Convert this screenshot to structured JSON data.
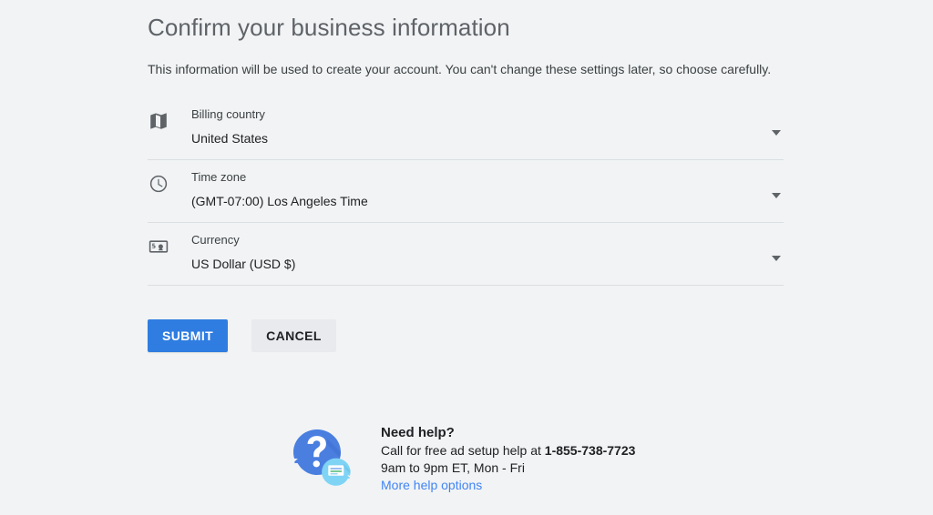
{
  "header": {
    "title": "Confirm your business information",
    "subtitle": "This information will be used to create your account. You can't change these settings later, so choose carefully."
  },
  "form": {
    "fields": [
      {
        "icon": "map-icon",
        "label": "Billing country",
        "value": "United States",
        "arrow": "chevron-down-icon"
      },
      {
        "icon": "clock-icon",
        "label": "Time zone",
        "value": "(GMT-07:00) Los Angeles Time",
        "arrow": "chevron-down-icon"
      },
      {
        "icon": "banknote-icon",
        "label": "Currency",
        "value": "US Dollar (USD $)",
        "arrow": "chevron-down-icon"
      }
    ]
  },
  "actions": {
    "submit_label": "SUBMIT",
    "cancel_label": "CANCEL"
  },
  "help": {
    "icon": "question-chat-bubble-icon",
    "title": "Need help?",
    "call_prefix": "Call for free ad setup help at ",
    "phone": "1-855-738-7723",
    "hours": "9am to 9pm ET, Mon - Fri",
    "link_label": "More help options"
  },
  "colors": {
    "background": "#f1f3f4",
    "submit_blue": "#2f7de1",
    "cancel_gray": "#e8eaed",
    "link_blue": "#4285f4",
    "title_gray": "#5f6368",
    "text_dark": "#202124",
    "divider": "#dcdfe1"
  }
}
